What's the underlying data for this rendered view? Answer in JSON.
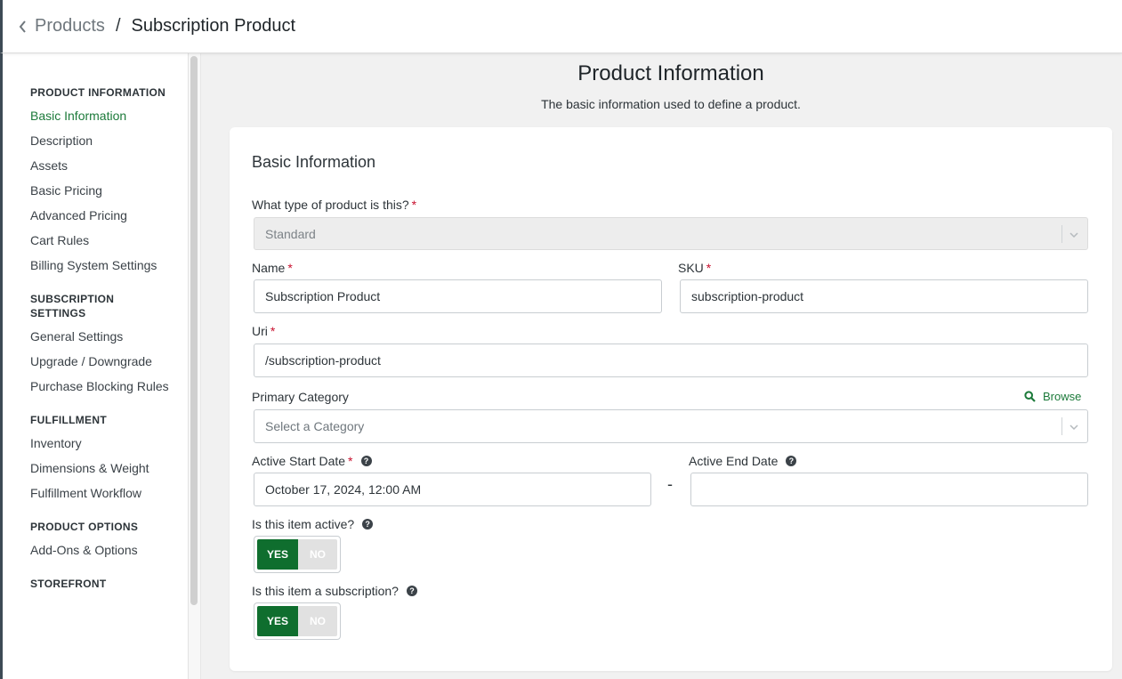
{
  "header": {
    "back_label": "Products",
    "separator": "/",
    "current": "Subscription Product"
  },
  "sidebar": {
    "sections": [
      {
        "title": "PRODUCT INFORMATION",
        "items": [
          "Basic Information",
          "Description",
          "Assets",
          "Basic Pricing",
          "Advanced Pricing",
          "Cart Rules",
          "Billing System Settings"
        ]
      },
      {
        "title": "SUBSCRIPTION SETTINGS",
        "items": [
          "General Settings",
          "Upgrade / Downgrade",
          "Purchase Blocking Rules"
        ]
      },
      {
        "title": "FULFILLMENT",
        "items": [
          "Inventory",
          "Dimensions & Weight",
          "Fulfillment Workflow"
        ]
      },
      {
        "title": "PRODUCT OPTIONS",
        "items": [
          "Add-Ons & Options"
        ]
      },
      {
        "title": "STOREFRONT",
        "items": []
      }
    ],
    "active_item": "Basic Information"
  },
  "main": {
    "title": "Product Information",
    "subtitle": "The basic information used to define a product."
  },
  "form": {
    "card_title": "Basic Information",
    "product_type": {
      "label": "What type of product is this?",
      "value": "Standard"
    },
    "name": {
      "label": "Name",
      "value": "Subscription Product"
    },
    "sku": {
      "label": "SKU",
      "value": "subscription-product"
    },
    "uri": {
      "label": "Uri",
      "value": "/subscription-product"
    },
    "category": {
      "label": "Primary Category",
      "placeholder": "Select a Category",
      "browse": "Browse"
    },
    "start_date": {
      "label": "Active Start Date",
      "value": "October 17, 2024, 12:00 AM"
    },
    "end_date": {
      "label": "Active End Date",
      "value": ""
    },
    "date_separator": "-",
    "active": {
      "label": "Is this item active?",
      "yes": "YES",
      "no": "NO",
      "value": true
    },
    "subscription": {
      "label": "Is this item a subscription?",
      "yes": "YES",
      "no": "NO",
      "value": true
    },
    "required_mark": "*",
    "help_mark": "?"
  },
  "colors": {
    "accent": "#1c7a3a",
    "toggle_on": "#0f6e2e",
    "required": "#c8102e"
  }
}
